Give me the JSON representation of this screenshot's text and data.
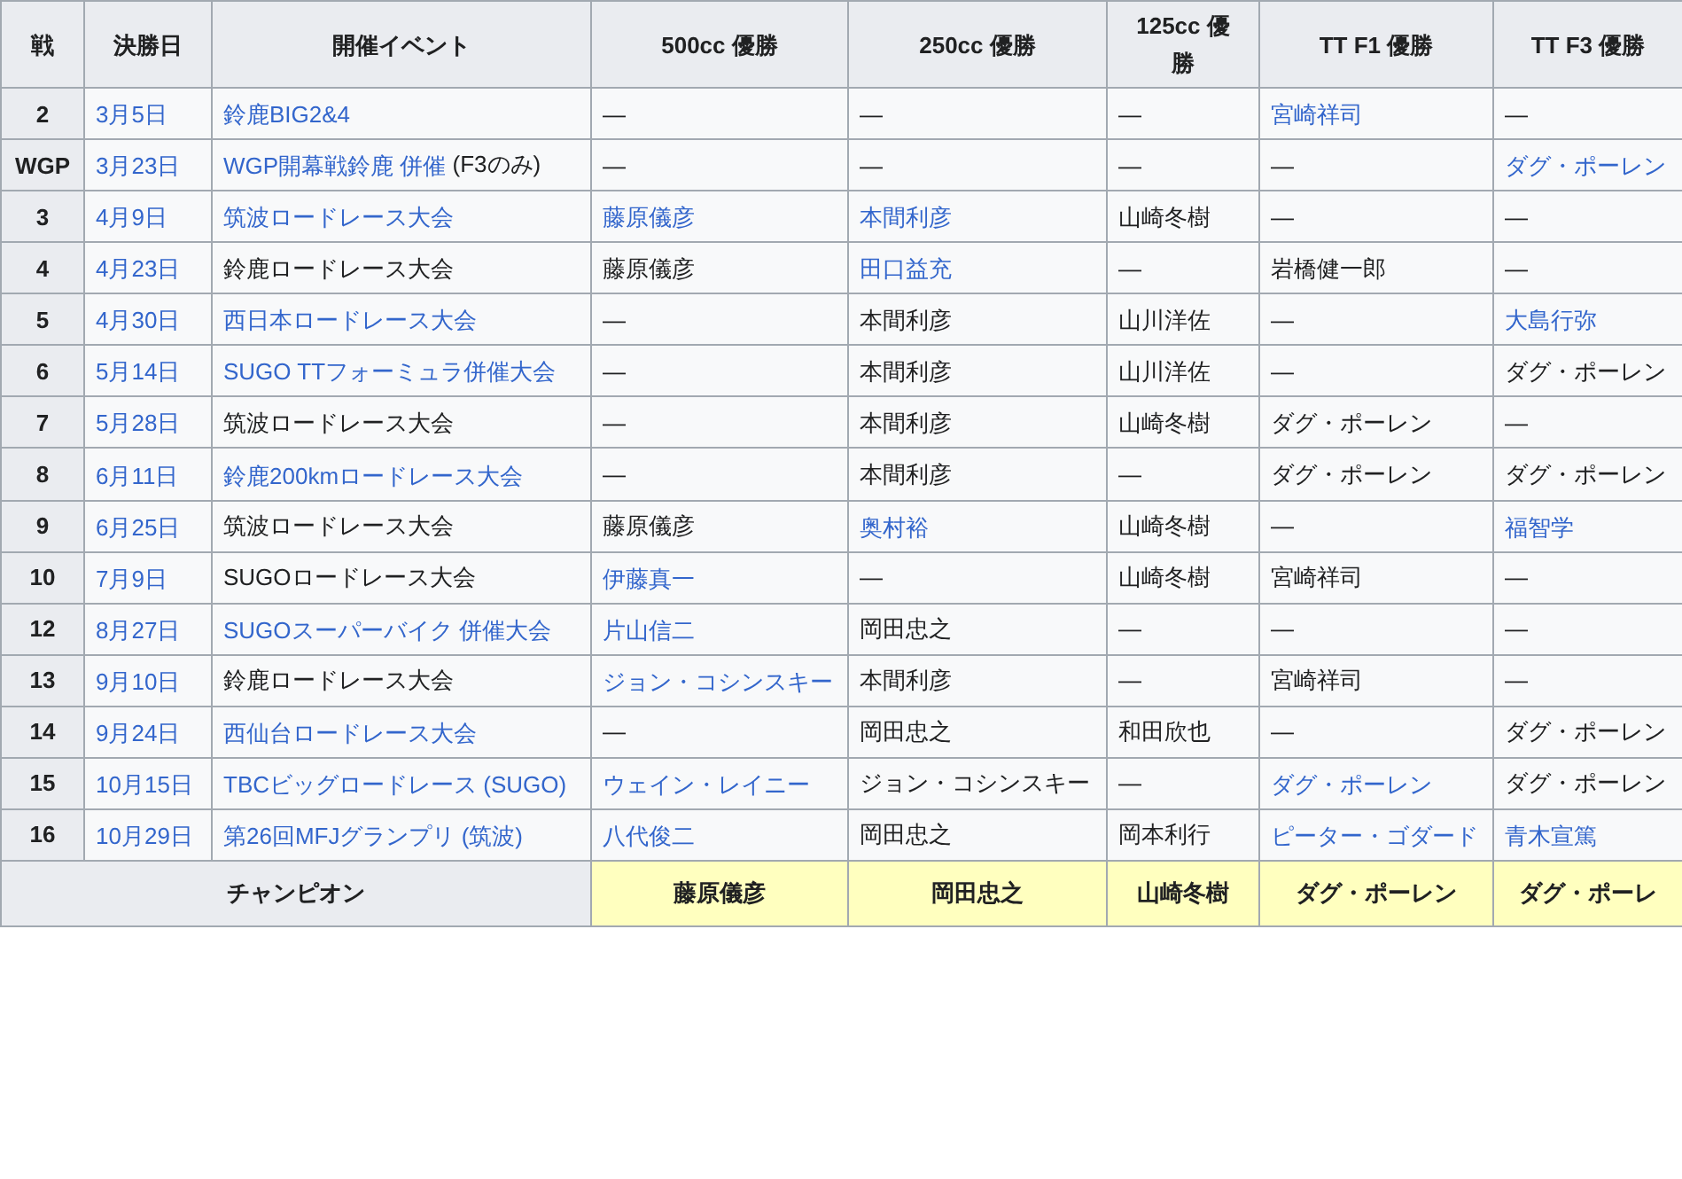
{
  "table": {
    "columns": [
      "戦",
      "決勝日",
      "開催イベント",
      "500cc 優勝",
      "250cc 優勝",
      "125cc 優勝",
      "TT F1 優勝",
      "TT F3 優勝"
    ],
    "rows": [
      {
        "cells": [
          {
            "kind": "round",
            "text": "2"
          },
          {
            "text": "3月5日",
            "link": true
          },
          {
            "text": "鈴鹿BIG2&4",
            "link": true
          },
          {
            "text": "—",
            "link": false
          },
          {
            "text": "—",
            "link": false
          },
          {
            "text": "—",
            "link": false
          },
          {
            "text": "宮崎祥司",
            "link": true
          },
          {
            "text": "—",
            "link": false
          }
        ]
      },
      {
        "cells": [
          {
            "kind": "round",
            "text": "WGP"
          },
          {
            "text": "3月23日",
            "link": true
          },
          {
            "text": "WGP開幕戦鈴鹿 併催",
            "link": true,
            "note": "(F3のみ)"
          },
          {
            "text": "—",
            "link": false
          },
          {
            "text": "—",
            "link": false
          },
          {
            "text": "—",
            "link": false
          },
          {
            "text": "—",
            "link": false
          },
          {
            "text": "ダグ・ポーレン",
            "link": true
          }
        ]
      },
      {
        "cells": [
          {
            "kind": "round",
            "text": "3"
          },
          {
            "text": "4月9日",
            "link": true
          },
          {
            "text": "筑波ロードレース大会",
            "link": true
          },
          {
            "text": "藤原儀彦",
            "link": true
          },
          {
            "text": "本間利彦",
            "link": true
          },
          {
            "text": "山崎冬樹",
            "link": false
          },
          {
            "text": "—",
            "link": false
          },
          {
            "text": "—",
            "link": false
          }
        ]
      },
      {
        "cells": [
          {
            "kind": "round",
            "text": "4"
          },
          {
            "text": "4月23日",
            "link": true
          },
          {
            "text": "鈴鹿ロードレース大会",
            "link": false
          },
          {
            "text": "藤原儀彦",
            "link": false
          },
          {
            "text": "田口益充",
            "link": true
          },
          {
            "text": "—",
            "link": false
          },
          {
            "text": "岩橋健一郎",
            "link": false
          },
          {
            "text": "—",
            "link": false
          }
        ]
      },
      {
        "cells": [
          {
            "kind": "round",
            "text": "5"
          },
          {
            "text": "4月30日",
            "link": true
          },
          {
            "text": "西日本ロードレース大会",
            "link": true
          },
          {
            "text": "—",
            "link": false
          },
          {
            "text": "本間利彦",
            "link": false
          },
          {
            "text": "山川洋佐",
            "link": false
          },
          {
            "text": "—",
            "link": false
          },
          {
            "text": "大島行弥",
            "link": true
          }
        ]
      },
      {
        "cells": [
          {
            "kind": "round",
            "text": "6"
          },
          {
            "text": "5月14日",
            "link": true
          },
          {
            "text": "SUGO TTフォーミュラ併催大会",
            "link": true
          },
          {
            "text": "—",
            "link": false
          },
          {
            "text": "本間利彦",
            "link": false
          },
          {
            "text": "山川洋佐",
            "link": false
          },
          {
            "text": "—",
            "link": false
          },
          {
            "text": "ダグ・ポーレン",
            "link": false
          }
        ]
      },
      {
        "cells": [
          {
            "kind": "round",
            "text": "7"
          },
          {
            "text": "5月28日",
            "link": true
          },
          {
            "text": "筑波ロードレース大会",
            "link": false
          },
          {
            "text": "—",
            "link": false
          },
          {
            "text": "本間利彦",
            "link": false
          },
          {
            "text": "山崎冬樹",
            "link": false
          },
          {
            "text": "ダグ・ポーレン",
            "link": false
          },
          {
            "text": "—",
            "link": false
          }
        ]
      },
      {
        "cells": [
          {
            "kind": "round",
            "text": "8"
          },
          {
            "text": "6月11日",
            "link": true
          },
          {
            "text": "鈴鹿200kmロードレース大会",
            "link": true
          },
          {
            "text": "—",
            "link": false
          },
          {
            "text": "本間利彦",
            "link": false
          },
          {
            "text": "—",
            "link": false
          },
          {
            "text": "ダグ・ポーレン",
            "link": false
          },
          {
            "text": "ダグ・ポーレン",
            "link": false
          }
        ]
      },
      {
        "cells": [
          {
            "kind": "round",
            "text": "9"
          },
          {
            "text": "6月25日",
            "link": true
          },
          {
            "text": "筑波ロードレース大会",
            "link": false
          },
          {
            "text": "藤原儀彦",
            "link": false
          },
          {
            "text": "奥村裕",
            "link": true
          },
          {
            "text": "山崎冬樹",
            "link": false
          },
          {
            "text": "—",
            "link": false
          },
          {
            "text": "福智学",
            "link": true
          }
        ]
      },
      {
        "cells": [
          {
            "kind": "round",
            "text": "10"
          },
          {
            "text": "7月9日",
            "link": true
          },
          {
            "text": "SUGOロードレース大会",
            "link": false
          },
          {
            "text": "伊藤真一",
            "link": true
          },
          {
            "text": "—",
            "link": false
          },
          {
            "text": "山崎冬樹",
            "link": false
          },
          {
            "text": "宮崎祥司",
            "link": false
          },
          {
            "text": "—",
            "link": false
          }
        ]
      },
      {
        "cells": [
          {
            "kind": "round",
            "text": "12"
          },
          {
            "text": "8月27日",
            "link": true
          },
          {
            "text": "SUGOスーパーバイク 併催大会",
            "link": true
          },
          {
            "text": "片山信二",
            "link": true
          },
          {
            "text": "岡田忠之",
            "link": false
          },
          {
            "text": "—",
            "link": false
          },
          {
            "text": "—",
            "link": false
          },
          {
            "text": "—",
            "link": false
          }
        ]
      },
      {
        "cells": [
          {
            "kind": "round",
            "text": "13"
          },
          {
            "text": "9月10日",
            "link": true
          },
          {
            "text": "鈴鹿ロードレース大会",
            "link": false
          },
          {
            "text": "ジョン・コシンスキー",
            "link": true
          },
          {
            "text": "本間利彦",
            "link": false
          },
          {
            "text": "—",
            "link": false
          },
          {
            "text": "宮崎祥司",
            "link": false
          },
          {
            "text": "—",
            "link": false
          }
        ]
      },
      {
        "cells": [
          {
            "kind": "round",
            "text": "14"
          },
          {
            "text": "9月24日",
            "link": true
          },
          {
            "text": "西仙台ロードレース大会",
            "link": true
          },
          {
            "text": "—",
            "link": false
          },
          {
            "text": "岡田忠之",
            "link": false
          },
          {
            "text": "和田欣也",
            "link": false
          },
          {
            "text": "—",
            "link": false
          },
          {
            "text": "ダグ・ポーレン",
            "link": false
          }
        ]
      },
      {
        "cells": [
          {
            "kind": "round",
            "text": "15"
          },
          {
            "text": "10月15日",
            "link": true
          },
          {
            "text": "TBCビッグロードレース (SUGO)",
            "link": true
          },
          {
            "text": "ウェイン・レイニー",
            "link": true
          },
          {
            "text": "ジョン・コシンスキー",
            "link": false
          },
          {
            "text": "—",
            "link": false
          },
          {
            "text": "ダグ・ポーレン",
            "link": true
          },
          {
            "text": "ダグ・ポーレン",
            "link": false
          }
        ]
      },
      {
        "cells": [
          {
            "kind": "round",
            "text": "16"
          },
          {
            "text": "10月29日",
            "link": true
          },
          {
            "text": "第26回MFJグランプリ (筑波)",
            "link": true
          },
          {
            "text": "八代俊二",
            "link": true
          },
          {
            "text": "岡田忠之",
            "link": false
          },
          {
            "text": "岡本利行",
            "link": false
          },
          {
            "text": "ピーター・ゴダード",
            "link": true
          },
          {
            "text": "青木宣篤",
            "link": true
          }
        ]
      }
    ],
    "champions": {
      "label": "チャンピオン",
      "cells": [
        "藤原儀彦",
        "岡田忠之",
        "山崎冬樹",
        "ダグ・ポーレン",
        "ダグ・ポーレ"
      ]
    }
  }
}
